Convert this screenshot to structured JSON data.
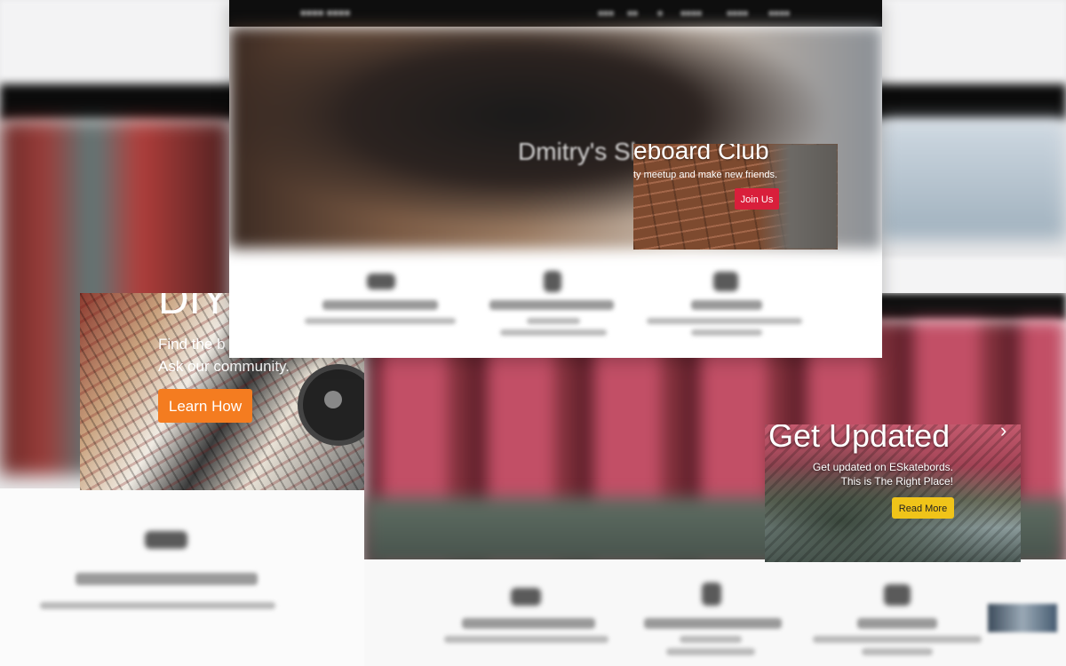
{
  "colors": {
    "learn_button": "#f47c20",
    "join_button": "#d91f3b",
    "read_more_button": "#f0c419"
  },
  "screenshot_a": {
    "hero_title_fragment": "eboard Club",
    "hero_sub_fragment": "ty meetup and make new friends.",
    "join_button_label": "Join Us"
  },
  "screenshot_b": {
    "title_fragment": "DIY",
    "line1_fragment": "Find the b",
    "line2": "Ask our community.",
    "learn_button_label": "Learn How"
  },
  "carousel_card": {
    "title": "Get Updated",
    "line1": "Get updated on ESkatebords.",
    "line2": "This is The Right Place!",
    "read_more_label": "Read More",
    "next_icon": "chevron-right-icon"
  }
}
